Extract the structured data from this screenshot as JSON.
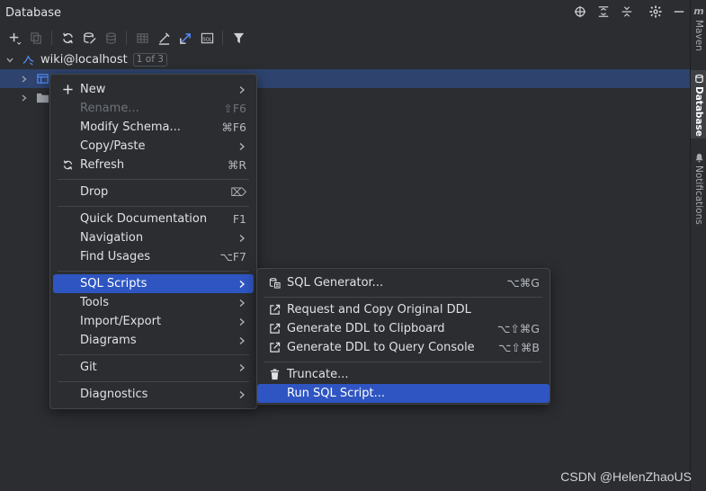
{
  "panel": {
    "title": "Database"
  },
  "tree": {
    "datasource_label": "wiki@localhost",
    "datasource_badge": "1 of 3"
  },
  "right_strip": {
    "tabs": [
      {
        "label": "Maven",
        "icon": "maven-icon"
      },
      {
        "label": "Database",
        "icon": "database-icon",
        "active": true
      },
      {
        "label": "Notifications",
        "icon": "bell-icon"
      }
    ]
  },
  "context_menu": {
    "items": [
      {
        "label": "New",
        "shortcut": "",
        "submenu": true,
        "icon": "plus-icon"
      },
      {
        "label": "Rename...",
        "shortcut": "⇧F6",
        "disabled": true
      },
      {
        "label": "Modify Schema...",
        "shortcut": "⌘F6"
      },
      {
        "label": "Copy/Paste",
        "submenu": true
      },
      {
        "label": "Refresh",
        "shortcut": "⌘R",
        "icon": "refresh-icon"
      },
      {
        "label": "Drop",
        "shortcut": "⌦"
      },
      {
        "label": "Quick Documentation",
        "shortcut": "F1"
      },
      {
        "label": "Navigation",
        "submenu": true
      },
      {
        "label": "Find Usages",
        "shortcut": "⌥F7"
      },
      {
        "label": "SQL Scripts",
        "submenu": true,
        "active": true
      },
      {
        "label": "Tools",
        "submenu": true
      },
      {
        "label": "Import/Export",
        "submenu": true
      },
      {
        "label": "Diagrams",
        "submenu": true
      },
      {
        "label": "Git",
        "submenu": true
      },
      {
        "label": "Diagnostics",
        "submenu": true
      }
    ]
  },
  "submenu": {
    "items": [
      {
        "label": "SQL Generator...",
        "shortcut": "⌥⌘G",
        "icon": "sql-generator-icon"
      },
      {
        "label": "Request and Copy Original DDL",
        "shortcut": "",
        "icon": "external-link-icon"
      },
      {
        "label": "Generate DDL to Clipboard",
        "shortcut": "⌥⇧⌘G",
        "icon": "external-link-icon"
      },
      {
        "label": "Generate DDL to Query Console",
        "shortcut": "⌥⇧⌘B",
        "icon": "external-link-icon"
      },
      {
        "label": "Truncate...",
        "shortcut": "",
        "icon": "trash-icon"
      },
      {
        "label": "Run SQL Script...",
        "shortcut": "",
        "active": true
      }
    ]
  },
  "watermark": "CSDN @HelenZhaoUS",
  "colors": {
    "background": "#2b2d30",
    "selection": "#2e436e",
    "menu_active": "#2e55c2",
    "accent_blue": "#548af7"
  }
}
